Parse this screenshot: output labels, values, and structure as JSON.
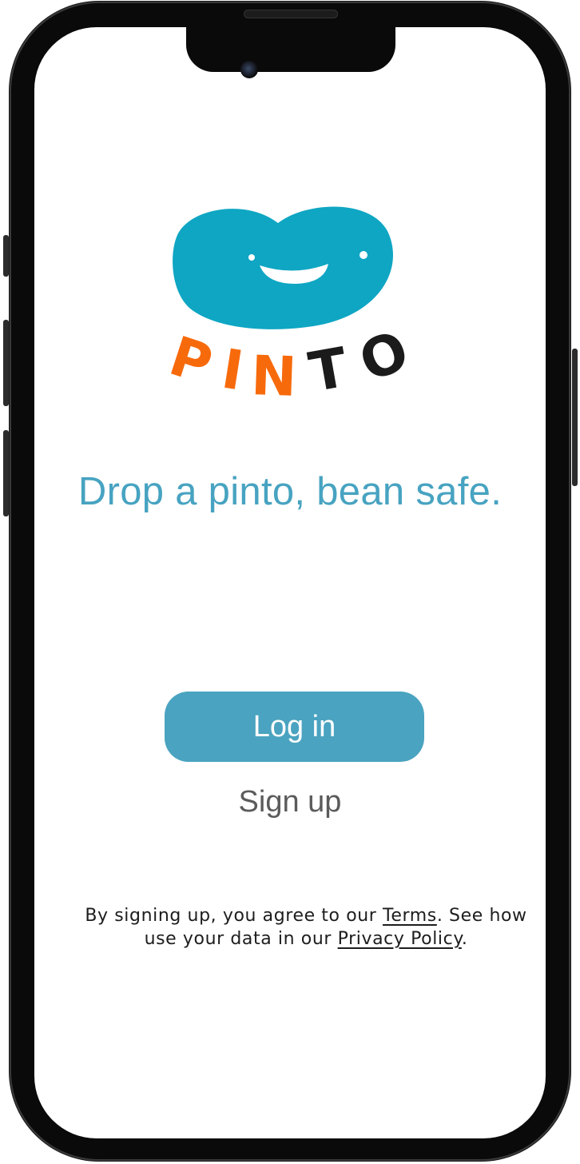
{
  "app": {
    "logo_text": "PINTO",
    "logo_letters": [
      "P",
      "I",
      "N",
      "T",
      "O"
    ],
    "colors": {
      "bean": "#0ea6c3",
      "orange": "#f76a0c",
      "dark": "#1b1b1b",
      "accent": "#4aa3c0",
      "tagline": "#47a3c1"
    }
  },
  "tagline": "Drop a pinto, bean safe.",
  "actions": {
    "login_label": "Log in",
    "signup_label": "Sign up"
  },
  "legal": {
    "part1": "By signing up, you agree to our ",
    "terms_link": "Terms",
    "part2": ". See how use your data in our ",
    "privacy_link": "Privacy Policy",
    "part3": "."
  }
}
